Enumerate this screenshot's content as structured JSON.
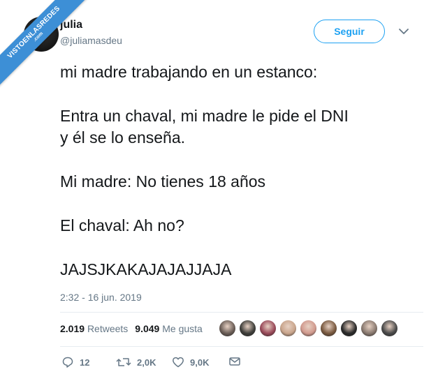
{
  "watermark": {
    "line1": "VISTOENLASREDES",
    "line2": ".com"
  },
  "author": {
    "name": "julia",
    "handle": "@juliamasdeu"
  },
  "follow_button": {
    "label": "Seguir"
  },
  "tweet": {
    "paragraphs": [
      [
        "mi madre trabajando en un estanco:"
      ],
      [
        "Entra un chaval, mi madre le pide el DNI",
        "y él se lo enseña."
      ],
      [
        "Mi madre: No tienes 18 años"
      ],
      [
        "El chaval: Ah no?"
      ],
      [
        "JAJSJKAKAJAJAJJAJA"
      ]
    ]
  },
  "timestamp": "2:32 - 16 jun. 2019",
  "stats": {
    "retweets_count": "2.019",
    "retweets_label": "Retweets",
    "likes_count": "9.049",
    "likes_label": "Me gusta"
  },
  "likers": [
    {
      "name": "liker-avatar-1",
      "color": "#6b5e57"
    },
    {
      "name": "liker-avatar-2",
      "color": "#3e3e3a"
    },
    {
      "name": "liker-avatar-3",
      "color": "#9a4a5a"
    },
    {
      "name": "liker-avatar-4",
      "color": "#c9a58c"
    },
    {
      "name": "liker-avatar-5",
      "color": "#d19a8e"
    },
    {
      "name": "liker-avatar-6",
      "color": "#7a5a40"
    },
    {
      "name": "liker-avatar-7",
      "color": "#2a2a2a"
    },
    {
      "name": "liker-avatar-8",
      "color": "#8a7a70"
    },
    {
      "name": "liker-avatar-9",
      "color": "#4a4a4a"
    }
  ],
  "actions": {
    "replies": "12",
    "retweets": "2,0K",
    "likes": "9,0K"
  },
  "colors": {
    "accent": "#1da1f2",
    "muted": "#657786",
    "divider": "#e6ecf0",
    "ribbon": "#3d8fd6"
  }
}
